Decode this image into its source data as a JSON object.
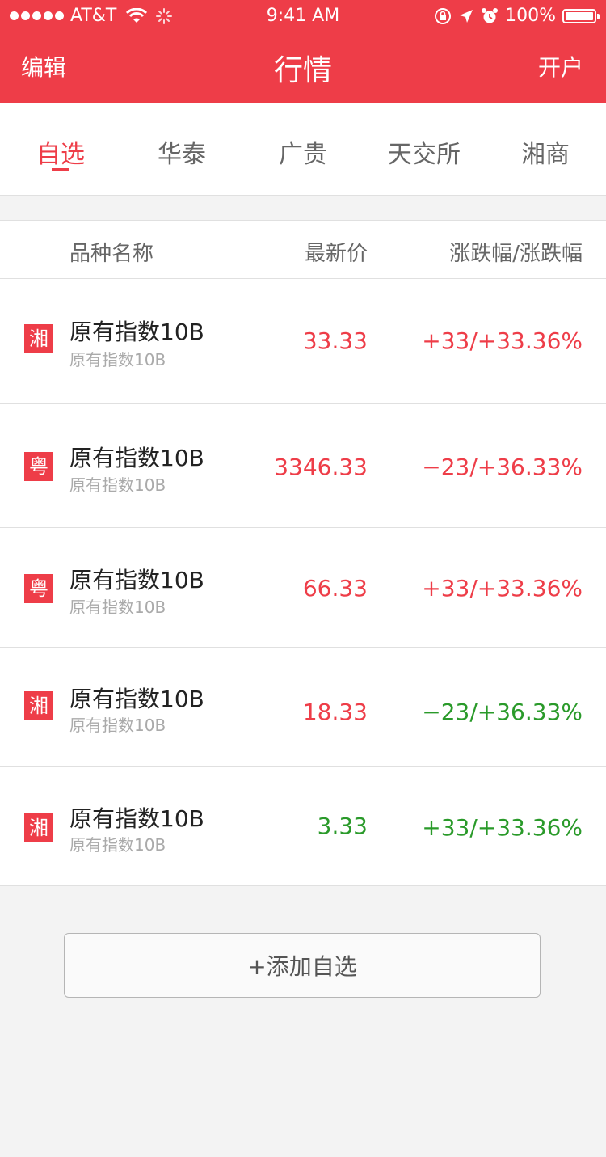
{
  "status_bar": {
    "carrier": "AT&T",
    "time": "9:41 AM",
    "battery": "100%"
  },
  "nav": {
    "left": "编辑",
    "title": "行情",
    "right": "开户"
  },
  "tabs": [
    {
      "label": "自选",
      "active": true
    },
    {
      "label": "华泰",
      "active": false
    },
    {
      "label": "广贵",
      "active": false
    },
    {
      "label": "天交所",
      "active": false
    },
    {
      "label": "湘商",
      "active": false
    }
  ],
  "table": {
    "headers": {
      "name": "品种名称",
      "price": "最新价",
      "change": "涨跌幅/涨跌幅"
    },
    "rows": [
      {
        "badge": "湘",
        "name": "原有指数10B",
        "sub": "原有指数10B",
        "price": "33.33",
        "price_color": "#ee3d48",
        "change": "+33/+33.36%",
        "change_color": "#ee3d48"
      },
      {
        "badge": "粤",
        "name": "原有指数10B",
        "sub": "原有指数10B",
        "price": "3346.33",
        "price_color": "#ee3d48",
        "change": "−23/+36.33%",
        "change_color": "#ee3d48"
      },
      {
        "badge": "粤",
        "name": "原有指数10B",
        "sub": "原有指数10B",
        "price": "66.33",
        "price_color": "#ee3d48",
        "change": "+33/+33.36%",
        "change_color": "#ee3d48"
      },
      {
        "badge": "湘",
        "name": "原有指数10B",
        "sub": "原有指数10B",
        "price": "18.33",
        "price_color": "#ee3d48",
        "change": "−23/+36.33%",
        "change_color": "#2a9a2a"
      },
      {
        "badge": "湘",
        "name": "原有指数10B",
        "sub": "原有指数10B",
        "price": "3.33",
        "price_color": "#2a9a2a",
        "change": "+33/+33.36%",
        "change_color": "#2a9a2a"
      }
    ]
  },
  "add_button": "+添加自选",
  "colors": {
    "brand": "#ee3d48",
    "up": "#ee3d48",
    "down": "#2a9a2a"
  },
  "icons": [
    "signal-dots-icon",
    "wifi-icon",
    "activity-icon",
    "lock-rotation-icon",
    "location-arrow-icon",
    "alarm-icon",
    "battery-icon"
  ]
}
